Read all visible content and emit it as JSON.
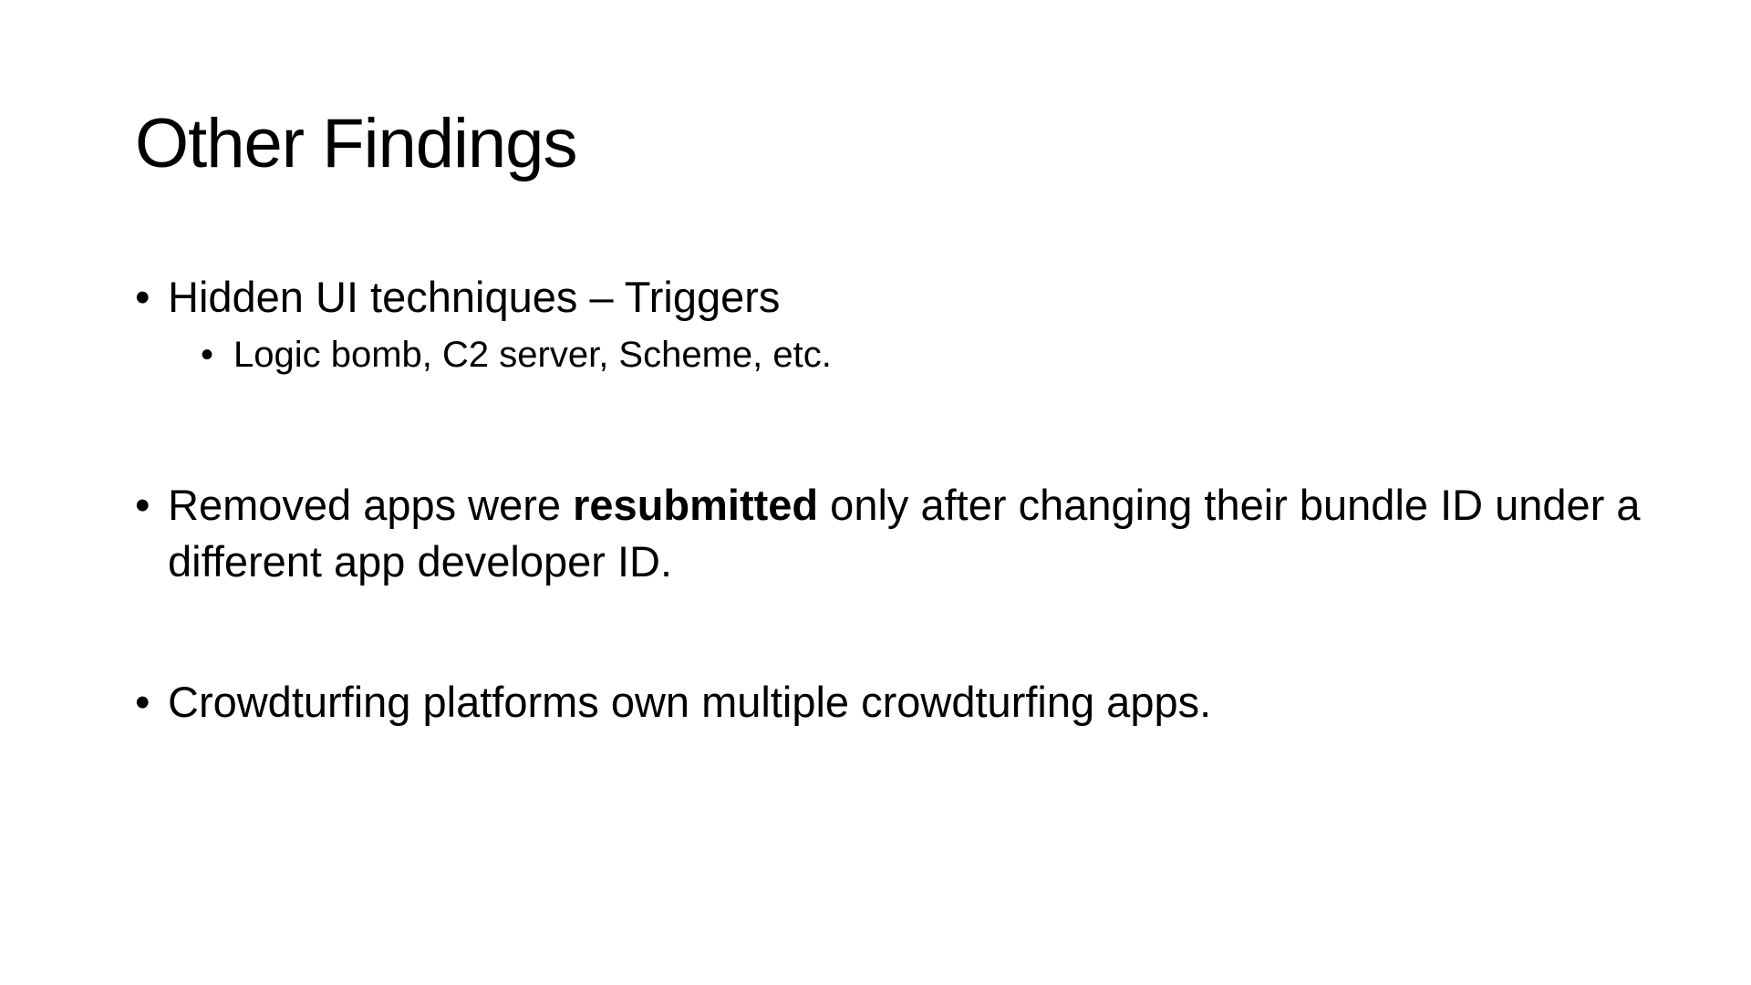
{
  "slide": {
    "title": "Other Findings",
    "bullet_symbol": "•",
    "bullets": [
      {
        "text": "Hidden UI techniques – Triggers",
        "sub_bullets": [
          {
            "text": "Logic bomb, C2 server, Scheme, etc."
          }
        ]
      },
      {
        "text_before": "Removed apps were ",
        "text_bold": "resubmitted",
        "text_after": " only after changing their bundle ID under a different app developer ID."
      },
      {
        "text": "Crowdturfing platforms own multiple crowdturfing apps."
      }
    ]
  }
}
